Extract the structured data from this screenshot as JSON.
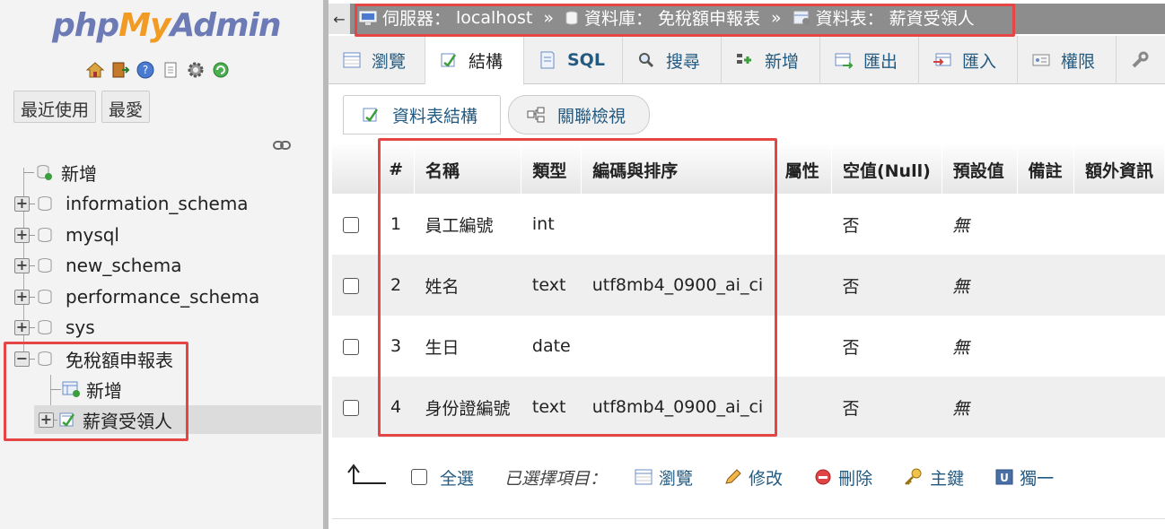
{
  "colors": {
    "accent": "#235a81",
    "annotation": "#e64545",
    "logo_php": "#6c7ab5",
    "logo_my": "#f29b24"
  },
  "nav": {
    "logo": {
      "php": "php",
      "my": "My",
      "admin": "Admin"
    },
    "icons": [
      "home-icon",
      "exit-icon",
      "help-icon",
      "docs-icon",
      "settings-icon",
      "reload-icon"
    ],
    "recent_label": "最近使用",
    "favorites_label": "最愛",
    "tree": [
      {
        "label": "新增",
        "type": "new"
      },
      {
        "label": "information_schema",
        "type": "db"
      },
      {
        "label": "mysql",
        "type": "db"
      },
      {
        "label": "new_schema",
        "type": "db"
      },
      {
        "label": "performance_schema",
        "type": "db"
      },
      {
        "label": "sys",
        "type": "db"
      },
      {
        "label": "免稅額申報表",
        "type": "db-open"
      },
      {
        "label": "新增",
        "type": "new-table"
      },
      {
        "label": "薪資受領人",
        "type": "table"
      }
    ]
  },
  "breadcrumb": {
    "server_label": "伺服器：",
    "server": "localhost",
    "db_label": "資料庫：",
    "db": "免稅額申報表",
    "table_label": "資料表：",
    "table": "薪資受領人",
    "separator": "»"
  },
  "tabs": [
    "瀏覽",
    "結構",
    "SQL",
    "搜尋",
    "新增",
    "匯出",
    "匯入",
    "權限"
  ],
  "active_tab": "結構",
  "subtabs": {
    "structure": "資料表結構",
    "relation": "關聯檢視"
  },
  "table": {
    "headers": [
      "#",
      "名稱",
      "類型",
      "編碼與排序",
      "屬性",
      "空值(Null)",
      "預設值",
      "備註",
      "額外資訊"
    ],
    "rows": [
      {
        "num": "1",
        "name": "員工編號",
        "type": "int",
        "collation": "",
        "attributes": "",
        "null": "否",
        "default": "無",
        "comment": "",
        "extra": ""
      },
      {
        "num": "2",
        "name": "姓名",
        "type": "text",
        "collation": "utf8mb4_0900_ai_ci",
        "attributes": "",
        "null": "否",
        "default": "無",
        "comment": "",
        "extra": ""
      },
      {
        "num": "3",
        "name": "生日",
        "type": "date",
        "collation": "",
        "attributes": "",
        "null": "否",
        "default": "無",
        "comment": "",
        "extra": ""
      },
      {
        "num": "4",
        "name": "身份證編號",
        "type": "text",
        "collation": "utf8mb4_0900_ai_ci",
        "attributes": "",
        "null": "否",
        "default": "無",
        "comment": "",
        "extra": ""
      }
    ]
  },
  "actions": {
    "select_all": "全選",
    "with_selected": "已選擇項目：",
    "browse": "瀏覽",
    "change": "修改",
    "drop": "刪除",
    "primary": "主鍵",
    "unique": "獨一"
  }
}
